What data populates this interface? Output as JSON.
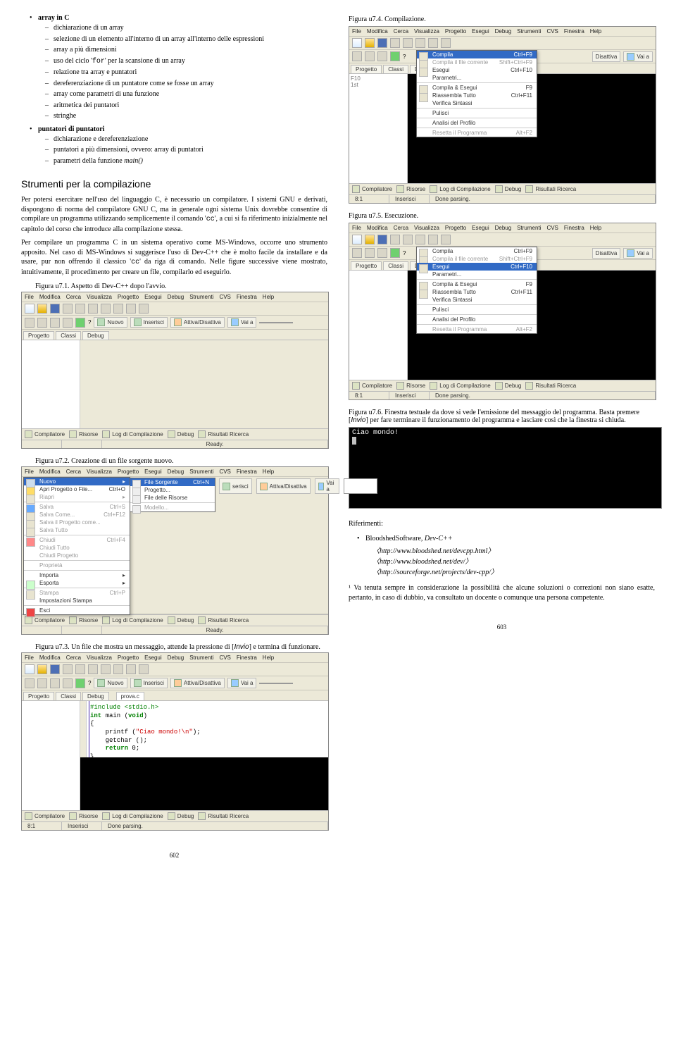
{
  "outline": {
    "l1a_title": "array in C",
    "l1a": [
      "dichiarazione di un array",
      "selezione di un elemento all'interno di un array all'interno delle espressioni",
      "array a più dimensioni",
      "uso del ciclo 'for' per la scansione di un array",
      "relazione tra array e puntatori",
      "dereferenziazione di un puntatore come se fosse un array",
      "array come parametri di una funzione",
      "aritmetica dei puntatori",
      "stringhe"
    ],
    "l1b_title": "puntatori di puntatori",
    "l1b": [
      "dichiarazione e dereferenziazione",
      "puntatori a più dimensioni, ovvero: array di puntatori",
      "parametri della funzione main()"
    ]
  },
  "section_title": "Strumenti per la compilazione",
  "para1": "Per potersi esercitare nell'uso del linguaggio C, è necessario un compilatore. I sistemi GNU e derivati, dispongono di norma del compilatore GNU C, ma in generale ogni sistema Unix dovrebbe consentire di compilare un programma utilizzando semplicemente il comando 'cc', a cui si fa riferimento inizialmente nel capitolo del corso che introduce alla compilazione stessa.",
  "para2": "Per compilare un programma C in un sistema operativo come MS-Windows, occorre uno strumento apposito. Nel caso di MS-Windows si suggerisce l'uso di Dev-C++ che è molto facile da installare e da usare, pur non offrendo il classico 'cc' da riga di comando. Nelle figure successive viene mostrato, intuitivamente, il procedimento per creare un file, compilarlo ed eseguirlo.",
  "cap1": "Figura u7.1. Aspetto di Dev-C++ dopo l'avvio.",
  "cap2": "Figura u7.2. Creazione di un file sorgente nuovo.",
  "cap3_a": "Figura u7.3. Un file che mostra un messaggio, attende la pressione di [",
  "cap3_key": "Invio",
  "cap3_b": "] e termina di funzionare.",
  "cap4": "Figura u7.4. Compilazione.",
  "cap5": "Figura u7.5. Esecuzione.",
  "cap6_a": "Figura u7.6. Finestra testuale da dove si vede l'emissione del messaggio del programma. Basta premere [",
  "cap6_key": "Invio",
  "cap6_b": "] per fare terminare il funzionamento del programma e lasciare così che la finestra si chiuda.",
  "console_out": "Ciao mondo!",
  "riferimenti_title": "Riferimenti:",
  "ref_main": "BloodshedSoftware, Dev-C++",
  "ref_urls": [
    "http://www.bloodshed.net/devcpp.html",
    "http://www.bloodshed.net/dev/",
    "http://sourceforge.net/projects/dev-cpp/"
  ],
  "footnote": "¹ Va tenuta sempre in considerazione la possibilità che alcune soluzioni o correzioni non siano esatte, pertanto, in caso di dubbio, va consultato un docente o comunque una persona competente.",
  "page_left": "602",
  "page_right": "603",
  "ide": {
    "menu": [
      "File",
      "Modifica",
      "Cerca",
      "Visualizza",
      "Progetto",
      "Esegui",
      "Debug",
      "Strumenti",
      "CVS",
      "Finestra",
      "Help"
    ],
    "btn_nuovo": "Nuovo",
    "btn_inserisci": "Inserisci",
    "btn_attiva": "Attiva/Disattiva",
    "btn_vaia": "Vai a",
    "tab_progetto": "Progetto",
    "tab_classi": "Classi",
    "tab_debug": "Debug",
    "tab_provac": "prova.c",
    "btabs": [
      "Compilatore",
      "Risorse",
      "Log di Compilazione",
      "Debug",
      "Risultati Ricerca"
    ],
    "status_ready": "Ready.",
    "status_line": "8:1",
    "status_ins": "Inserisci",
    "status_done": "Done parsing."
  },
  "menu_file": {
    "items": [
      {
        "label": "Nuovo",
        "sub": true,
        "sel": true
      },
      {
        "label": "Apri Progetto o File...",
        "sc": "Ctrl+O"
      },
      {
        "label": "Riapri",
        "sub": true,
        "grey": true
      }
    ],
    "group2": [
      {
        "label": "Salva",
        "sc": "Ctrl+S",
        "grey": true
      },
      {
        "label": "Salva Come...",
        "sc": "Ctrl+F12",
        "grey": true
      },
      {
        "label": "Salva il Progetto come...",
        "grey": true
      },
      {
        "label": "Salva Tutto",
        "grey": true
      }
    ],
    "group3": [
      {
        "label": "Chiudi",
        "sc": "Ctrl+F4",
        "grey": true
      },
      {
        "label": "Chiudi Tutto",
        "grey": true
      },
      {
        "label": "Chiudi Progetto",
        "grey": true
      }
    ],
    "group4": [
      {
        "label": "Proprietà",
        "grey": true
      }
    ],
    "group5": [
      {
        "label": "Importa",
        "sub": true
      },
      {
        "label": "Esporta",
        "sub": true
      }
    ],
    "group6": [
      {
        "label": "Stampa",
        "sc": "Ctrl+P",
        "grey": true
      },
      {
        "label": "Impostazioni Stampa"
      }
    ],
    "group7": [
      {
        "label": "Esci"
      }
    ],
    "sub_nuovo": [
      {
        "label": "File Sorgente",
        "sc": "Ctrl+N",
        "sel": true
      },
      {
        "label": "Progetto..."
      },
      {
        "label": "File delle Risorse"
      },
      {
        "label": "Modello...",
        "grey": true
      }
    ]
  },
  "menu_esegui_compila": {
    "items": [
      {
        "label": "Compila",
        "sc": "Ctrl+F9",
        "sel": true
      },
      {
        "label": "Compila il file corrente",
        "sc": "Shift+Ctrl+F9",
        "grey": true
      },
      {
        "label": "Esegui",
        "sc": "Ctrl+F10"
      },
      {
        "label": "Parametri..."
      }
    ],
    "group2": [
      {
        "label": "Compila & Esegui",
        "sc": "F9"
      },
      {
        "label": "Riassembla Tutto",
        "sc": "Ctrl+F11"
      },
      {
        "label": "Verifica Sintassi"
      }
    ],
    "group3": [
      {
        "label": "Pulisci"
      }
    ],
    "group4": [
      {
        "label": "Analisi del Profilo"
      }
    ],
    "group5": [
      {
        "label": "Resetta il Programma",
        "sc": "Alt+F2",
        "grey": true
      }
    ]
  },
  "menu_esegui_run": {
    "items": [
      {
        "label": "Compila",
        "sc": "Ctrl+F9"
      },
      {
        "label": "Compila il file corrente",
        "sc": "Shift+Ctrl+F9",
        "grey": true
      },
      {
        "label": "Esegui",
        "sc": "Ctrl+F10",
        "sel": true
      },
      {
        "label": "Parametri..."
      }
    ],
    "group2": [
      {
        "label": "Compila & Esegui",
        "sc": "F9"
      },
      {
        "label": "Riassembla Tutto",
        "sc": "Ctrl+F11"
      },
      {
        "label": "Verifica Sintassi"
      }
    ],
    "group3": [
      {
        "label": "Pulisci"
      }
    ],
    "group4": [
      {
        "label": "Analisi del Profilo"
      }
    ],
    "group5": [
      {
        "label": "Resetta il Programma",
        "sc": "Alt+F2",
        "grey": true
      }
    ]
  },
  "code": {
    "l1": "#include <stdio.h>",
    "l2a": "int",
    "l2b": " main (",
    "l2c": "void",
    "l2d": ")",
    "l3": "{",
    "l4a": "    printf (",
    "l4b": "\"Ciao mondo!\\n\"",
    "l4c": ");",
    "l5": "    getchar ();",
    "l6a": "    return",
    "l6b": " 0;",
    "l7": "}"
  }
}
